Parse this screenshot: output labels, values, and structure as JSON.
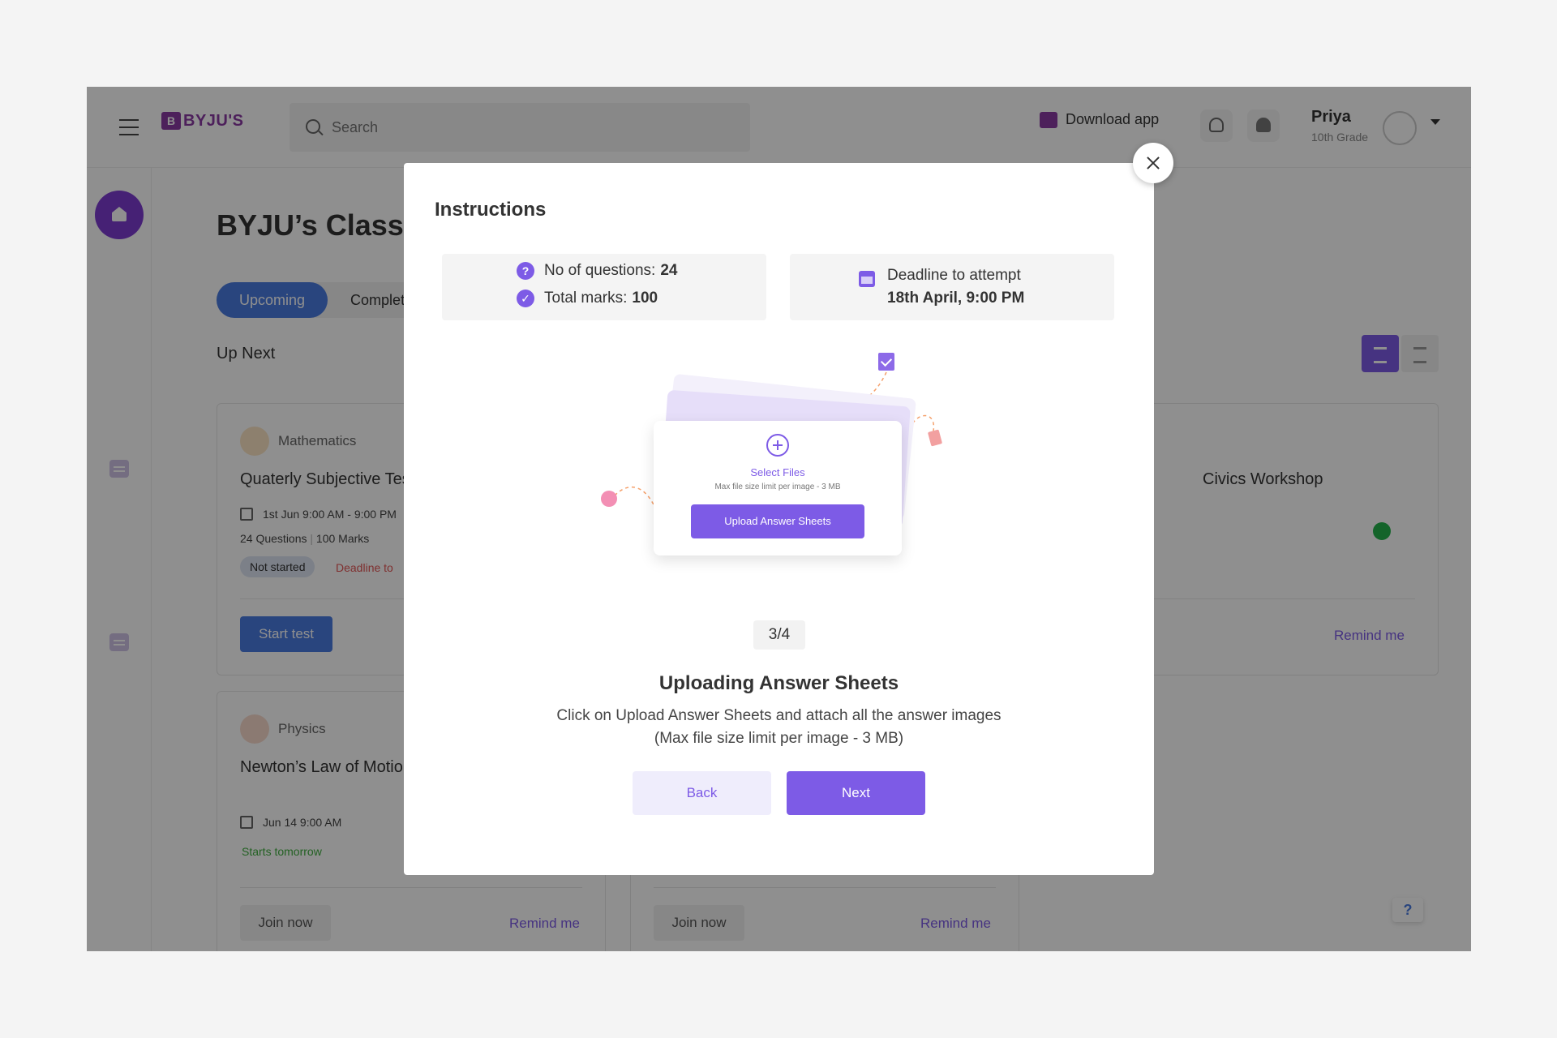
{
  "header": {
    "logo_text": "BYJU'S",
    "search_placeholder": "Search",
    "download_label": "Download app",
    "profile_name": "Priya",
    "profile_grade": "10th Grade"
  },
  "main": {
    "title": "BYJU’s Classes",
    "tabs": [
      "Upcoming",
      "Completed"
    ],
    "section_label": "Up Next",
    "cards": [
      {
        "subject": "Mathematics",
        "title": "Quaterly Subjective Test",
        "date": "1st Jun 9:00 AM - 9:00 PM",
        "questions": "24 Questions",
        "marks": "100 Marks",
        "status_badge": "Not started",
        "deadline": "Deadline to",
        "action": "Start test"
      },
      {
        "subject": "Physics",
        "title": "Newton’s Law of Motion",
        "date": "Jun 14 9:00 AM",
        "status": "Starts tomorrow",
        "action": "Join now",
        "remind": "Remind me"
      },
      {
        "action": "Join now",
        "remind": "Remind me"
      },
      {
        "title": "Civics Workshop",
        "remind": "Remind me"
      }
    ],
    "help_label": "?"
  },
  "modal": {
    "title": "Instructions",
    "questions_label": "No of questions:",
    "questions_value": "24",
    "marks_label": "Total marks:",
    "marks_value": "100",
    "deadline_label": "Deadline to attempt",
    "deadline_value": "18th April, 9:00 PM",
    "illustration": {
      "select_files": "Select Files",
      "max_size": "Max file size limit per image - 3 MB",
      "upload_button": "Upload Answer Sheets"
    },
    "step": "3/4",
    "step_title": "Uploading Answer Sheets",
    "step_description": "Click on Upload Answer Sheets and attach all the answer images (Max file size limit per image - 3 MB)",
    "back_label": "Back",
    "next_label": "Next"
  },
  "colors": {
    "accent": "#7d5be6",
    "blue": "#4a7be0",
    "brand": "#8a3aa3"
  }
}
